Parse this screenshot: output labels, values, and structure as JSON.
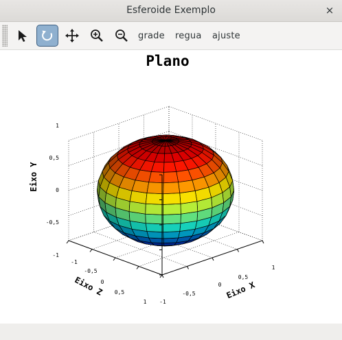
{
  "window": {
    "title": "Esferoide Exemplo",
    "close_glyph": "×"
  },
  "toolbar": {
    "tools": [
      {
        "name": "pointer",
        "icon": "arrow-pointer-icon",
        "active": false
      },
      {
        "name": "rotate",
        "icon": "rotate-icon",
        "active": true
      },
      {
        "name": "pan",
        "icon": "move-arrows-icon",
        "active": false
      },
      {
        "name": "zoom-in",
        "icon": "zoom-in-icon",
        "active": false
      },
      {
        "name": "zoom-out",
        "icon": "zoom-out-icon",
        "active": false
      }
    ],
    "labels": {
      "grid": "grade",
      "ruler": "regua",
      "fit": "ajuste"
    }
  },
  "plot": {
    "title": "Plano",
    "ylabel": "Eixo Y",
    "zlabel": "Eixo Z",
    "xlabel": "Eixo X",
    "yticks": [
      "1",
      "0,5",
      "0",
      "-0,5",
      "-1"
    ],
    "zticks": [
      "-1",
      "-0,5",
      "0",
      "0,5",
      "1"
    ],
    "xticks": [
      "-1",
      "-0,5",
      "0",
      "0,5",
      "1"
    ]
  },
  "chart_data": {
    "type": "surface",
    "title": "Plano",
    "surface": "sphere",
    "radius": 1,
    "colormap": "jet",
    "xlim": [
      -1,
      1
    ],
    "ylim": [
      -1,
      1
    ],
    "zlim": [
      -1,
      1
    ],
    "xlabel": "Eixo X",
    "ylabel": "Eixo Y",
    "zlabel": "Eixo Z",
    "grid": true
  },
  "colors": {
    "active_tool_bg": "#8fb0cf",
    "active_tool_border": "#3d5e80"
  }
}
